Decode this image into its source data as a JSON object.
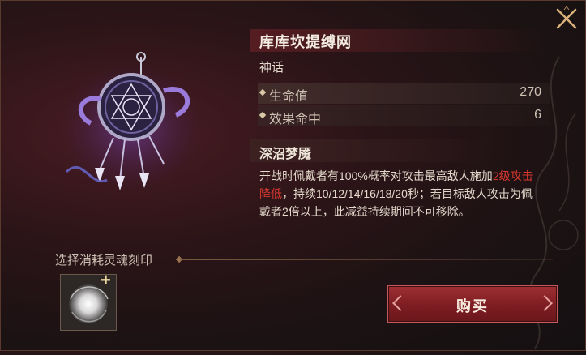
{
  "item": {
    "name": "库库坎提缚网",
    "rarity": "神话",
    "stats": [
      {
        "name": "生命值",
        "value": "270"
      },
      {
        "name": "效果命中",
        "value": "6"
      }
    ],
    "skill": {
      "name": "深沼梦魇",
      "desc_part1": "开战时佩戴者有100%概率对攻击最高敌人施加",
      "desc_highlight_a": "2级",
      "desc_highlight_b": "攻击降低",
      "desc_part2": "，持续10/12/14/16/18/20秒；若目标敌人攻击为佩戴者2倍以上，此减益持续期间不可移除。"
    },
    "art_icon": "dreamcatcher-icon"
  },
  "soul": {
    "label": "选择消耗灵魂刻印",
    "slot_icon": "soul-orb-icon",
    "add_symbol": "+"
  },
  "buy_button": {
    "label": "购买"
  },
  "colors": {
    "highlight": "#d9382e",
    "button": "#8a2328",
    "accent": "#b89a6a"
  }
}
